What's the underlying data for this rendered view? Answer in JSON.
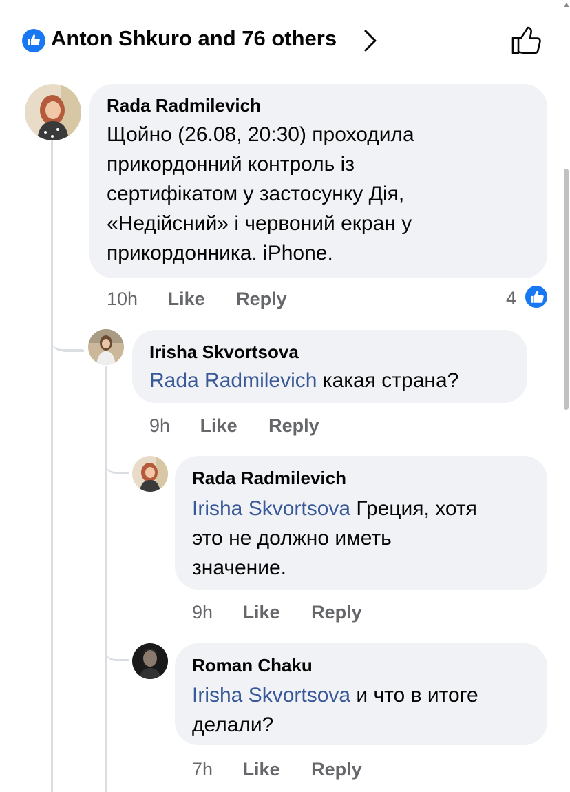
{
  "header": {
    "reactors_text": "Anton Shkuro and 76 others",
    "reaction_icon": "thumbs-up",
    "like_icon": "thumbs-up-outline"
  },
  "comments": [
    {
      "author": "Rada Radmilevich",
      "mention": "",
      "text_lines": [
        "Щойно (26.08, 20:30) проходила",
        "прикордонний контроль із",
        "сертифікатом у застосунку Дія,",
        "«Недійсний» і червоний екран у",
        "прикордонника. iPhone."
      ],
      "time": "10h",
      "like_label": "Like",
      "reply_label": "Reply",
      "reaction_count": "4"
    },
    {
      "author": "Irisha Skvortsova",
      "mention": "Rada Radmilevich",
      "text": " какая страна?",
      "time": "9h",
      "like_label": "Like",
      "reply_label": "Reply"
    },
    {
      "author": "Rada Radmilevich",
      "mention": "Irisha Skvortsova",
      "text_line1": " Греция, хотя",
      "text_line2": "это не должно иметь",
      "text_line3": "значение.",
      "time": "9h",
      "like_label": "Like",
      "reply_label": "Reply"
    },
    {
      "author": "Roman Chaku",
      "mention": "Irisha Skvortsova",
      "text_line1": " и что в итоге",
      "text_line2": "делали?",
      "time": "7h",
      "like_label": "Like",
      "reply_label": "Reply"
    }
  ],
  "colors": {
    "accent": "#1877f2",
    "mention": "#385898",
    "bubble": "#f0f2f5",
    "meta": "#65676b"
  }
}
